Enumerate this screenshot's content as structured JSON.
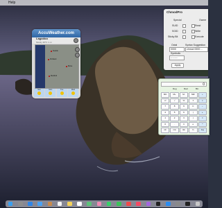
{
  "menubar": {
    "apple_glyph": "",
    "help_label": "Help"
  },
  "accuweather": {
    "title": "AccuWeather.com",
    "location": "Lagodoo",
    "location_sub": "Mostly 48°F 1 mi",
    "cities": [
      "Seattle",
      "Portland",
      "Boise",
      "Medford"
    ],
    "forecast": [
      {
        "day": "Sun"
      },
      {
        "day": "Mon"
      },
      {
        "day": "Tue"
      },
      {
        "day": "Wed"
      }
    ]
  },
  "chmod": {
    "title": "ChmodPro",
    "col_special": "Special",
    "col_owner": "Owner",
    "rows": [
      {
        "left": "SUID",
        "right": "Read"
      },
      {
        "left": "SGID",
        "right": "Write"
      },
      {
        "left": "Sticky Bit",
        "right": "Execute"
      }
    ],
    "octal_label": "Octal",
    "octal_value": "0000",
    "syntax_label": "Syntax Suggestion",
    "syntax_value": "chmod 0000 ...",
    "symbolic_label": "Symbolic",
    "symbolic_value": "---------",
    "apply_button": "Apply"
  },
  "calculator": {
    "display": "0",
    "modes": [
      "Deg",
      "Rad",
      "Bin"
    ],
    "keys": [
      "MC",
      "M+",
      "M-",
      "MR",
      "÷",
      "x²",
      "√",
      "%",
      "±",
      "×",
      "7",
      "8",
      "9",
      "C",
      "−",
      "4",
      "5",
      "6",
      "(",
      "+",
      "1",
      "2",
      "3",
      ")",
      "=",
      "0",
      ".",
      "π",
      "e",
      "^",
      "sin",
      "cos",
      "tan",
      "ln",
      "log"
    ]
  },
  "dock": {
    "icons": [
      "finder-icon",
      "launchpad-icon",
      "safari-icon",
      "mail-icon",
      "contacts-icon",
      "calendar-icon",
      "notes-icon",
      "reminders-icon",
      "maps-icon",
      "photos-icon",
      "messages-icon",
      "facetime-icon",
      "news-icon",
      "music-icon",
      "podcasts-icon",
      "tv-icon",
      "appstore-icon",
      "preferences-icon",
      "terminal-icon",
      "trash-icon"
    ],
    "colors": [
      "#3aa0f0",
      "#8e8e8e",
      "#2f86e8",
      "#4aa3f5",
      "#c98b4c",
      "#f5f5f5",
      "#f5d35c",
      "#ffffff",
      "#5cc37a",
      "#f08bb5",
      "#37d068",
      "#3bc35a",
      "#f04a4a",
      "#f44a64",
      "#a466e0",
      "#222222",
      "#2b8cf0",
      "#8a8a8a",
      "#222222",
      "#c8c8c8"
    ]
  },
  "colors": {
    "accu_header": "#2f66a6",
    "calc_bg": "#e7f4e2"
  }
}
